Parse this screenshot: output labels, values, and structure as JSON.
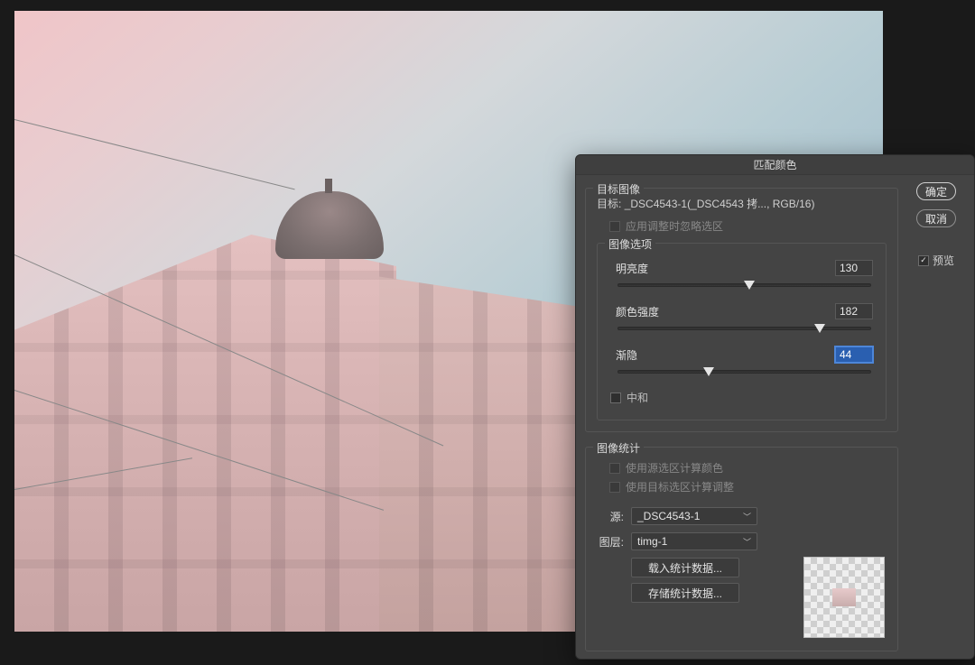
{
  "dialog": {
    "title": "匹配颜色",
    "buttons": {
      "ok": "确定",
      "cancel": "取消"
    },
    "preview_label": "预览",
    "preview_checked": true,
    "target_section": {
      "legend": "目标图像",
      "target_prefix": "目标:",
      "target_value": "_DSC4543-1(_DSC4543 拷..., RGB/16)",
      "ignore_selection_label": "应用调整时忽略选区",
      "ignore_selection_checked": false
    },
    "options_section": {
      "legend": "图像选项",
      "brightness": {
        "label": "明亮度",
        "value": "130",
        "pct": 52
      },
      "intensity": {
        "label": "颜色强度",
        "value": "182",
        "pct": 80
      },
      "fade": {
        "label": "渐隐",
        "value": "44",
        "pct": 36,
        "focused": true
      },
      "neutralize": {
        "label": "中和",
        "checked": false
      }
    },
    "stats_section": {
      "legend": "图像统计",
      "use_src_sel": {
        "label": "使用源选区计算颜色",
        "checked": false,
        "disabled": true
      },
      "use_tgt_sel": {
        "label": "使用目标选区计算调整",
        "checked": false,
        "disabled": true
      },
      "source_label": "源:",
      "source_value": "_DSC4543-1",
      "layer_label": "图层:",
      "layer_value": "timg-1",
      "load_btn": "载入统计数据...",
      "save_btn": "存储统计数据..."
    }
  }
}
